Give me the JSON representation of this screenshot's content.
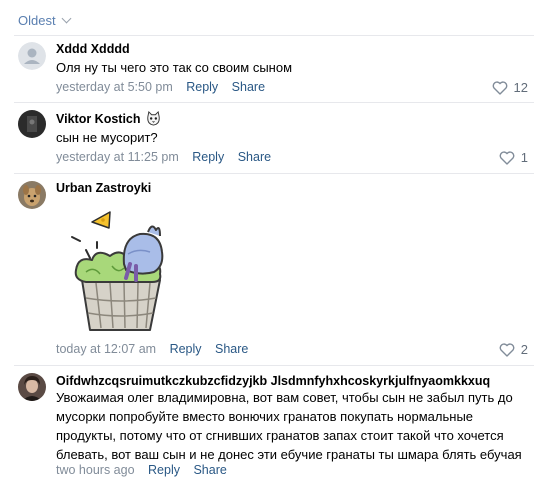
{
  "sort": {
    "label": "Oldest"
  },
  "comments": [
    {
      "author": "Xddd Xdddd",
      "text": "Оля ну ты чего это так со своим сыном",
      "time": "yesterday at 5:50 pm",
      "reply_label": "Reply",
      "share_label": "Share",
      "likes": "12",
      "avatar": "default-avatar"
    },
    {
      "author": "Viktor Kostich",
      "text": "сын не мусорит?",
      "time": "yesterday at 11:25 pm",
      "reply_label": "Reply",
      "share_label": "Share",
      "likes": "1",
      "avatar": "dark-photo-avatar"
    },
    {
      "author": "Urban Zastroyki",
      "sticker": "bird-in-trash-basket-sticker",
      "time": "today at 12:07 am",
      "reply_label": "Reply",
      "share_label": "Share",
      "likes": "2",
      "avatar": "dog-photo-avatar"
    },
    {
      "author": "Oifdwhzcqsruimutkczkubzcfidzyjkb Jlsdmnfyhxhcoskyrkjulfnyaomkkxuq",
      "text": "Увожаимая олег владимировна, вот вам совет, чтобы сын не забыл путь до мусорки попробуйте вместо вонючих гранатов покупать нормальные продукты, потому что от сгнивших гранатов запах стоит такой что хочется блевать, вот ваш сын и не донес эти ебучие гранаты ты шмара блять ебучая",
      "time": "two hours ago",
      "reply_label": "Reply",
      "share_label": "Share",
      "avatar": "girl-photo-avatar"
    }
  ],
  "colors": {
    "link": "#2a5885",
    "meta": "#818c99",
    "divider": "#e7e8ec"
  }
}
